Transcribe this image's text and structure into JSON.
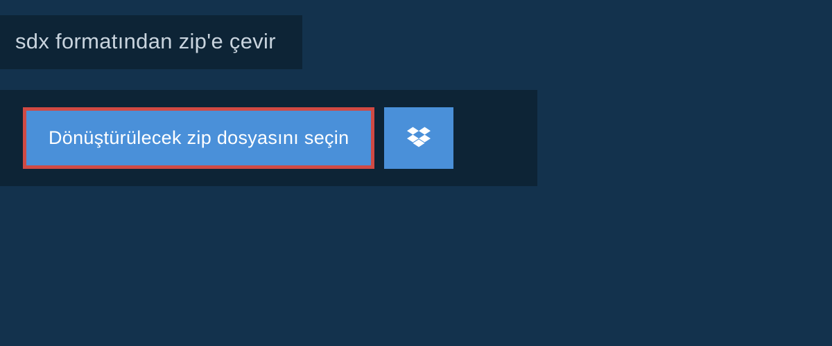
{
  "header": {
    "title": "sdx formatından zip'e çevir"
  },
  "upload": {
    "select_label": "Dönüştürülecek zip dosyasını seçin",
    "dropbox_icon_name": "dropbox-icon"
  },
  "colors": {
    "bg": "#13324d",
    "panel": "#0d2436",
    "button": "#4a90d9",
    "highlight_border": "#d04a44"
  }
}
